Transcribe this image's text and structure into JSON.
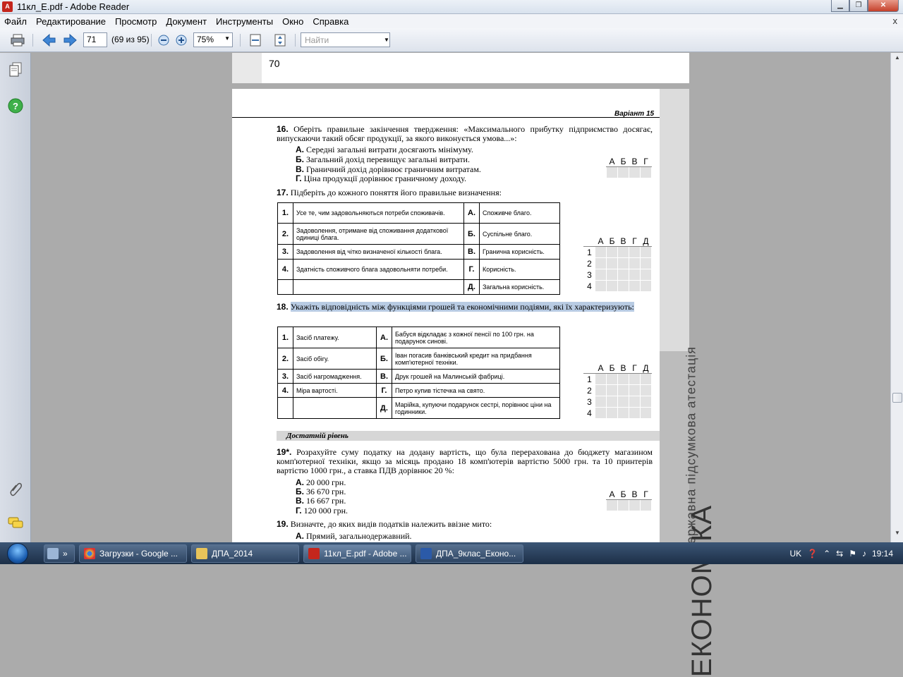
{
  "window": {
    "title": "11кл_Е.pdf - Adobe Reader"
  },
  "menu": [
    "Файл",
    "Редактирование",
    "Просмотр",
    "Документ",
    "Инструменты",
    "Окно",
    "Справка"
  ],
  "menu_close": "x",
  "toolbar": {
    "page_value": "71",
    "page_count": "(69 из 95)",
    "zoom": "75%",
    "find_placeholder": "Найти"
  },
  "prev_page_number": "70",
  "page": {
    "variant": "Варіант 15",
    "side_text_1": "Державна підсумкова атестація",
    "side_text_2": "ЕКОНОМІКА",
    "q16": {
      "number": "16.",
      "text": "Оберіть правильне закінчення твердження: «Максимального прибутку підприємство досягає, випускаючи такий обсяг продукції, за якого виконується умова...»:",
      "options": [
        {
          "letter": "А.",
          "text": "Середні загальні витрати досягають мінімуму."
        },
        {
          "letter": "Б.",
          "text": "Загальний дохід перевищує загальні витрати."
        },
        {
          "letter": "В.",
          "text": "Граничний дохід дорівнює граничним витратам."
        },
        {
          "letter": "Г.",
          "text": "Ціна продукції дорівнює граничному доходу."
        }
      ]
    },
    "q17": {
      "number": "17.",
      "text": "Підберіть до кожного поняття його правильне визначення:",
      "rows": [
        {
          "n": "1.",
          "left": "Усе те, чим задовольняються потреби споживачів.",
          "l": "А.",
          "right": "Споживче благо."
        },
        {
          "n": "2.",
          "left": "Задоволення, отримане від споживання додаткової одиниці блага.",
          "l": "Б.",
          "right": "Суспільне благо."
        },
        {
          "n": "3.",
          "left": "Задоволення від чітко визначеної кількості блага.",
          "l": "В.",
          "right": "Гранична корисність."
        },
        {
          "n": "4.",
          "left": "Здатність споживчого блага задовольняти потреби.",
          "l": "Г.",
          "right": "Корисність."
        },
        {
          "n": "",
          "left": "",
          "l": "Д.",
          "right": "Загальна корисність."
        }
      ]
    },
    "q18": {
      "number": "18.",
      "text": "Укажіть відповідність між функціями грошей та економічними подіями, які їх характеризують:",
      "rows": [
        {
          "n": "1.",
          "left": "Засіб платежу.",
          "l": "А.",
          "right": "Бабуся відкладає з кожної пенсії по 100 грн. на подарунок синові."
        },
        {
          "n": "2.",
          "left": "Засіб обігу.",
          "l": "Б.",
          "right": "Іван погасив банківський кредит на придбання комп'ютерної техніки."
        },
        {
          "n": "3.",
          "left": "Засіб нагромадження.",
          "l": "В.",
          "right": "Друк грошей на Малинській фабриці."
        },
        {
          "n": "4.",
          "left": "Міра вартості.",
          "l": "Г.",
          "right": "Петро купив тістечка на свято."
        },
        {
          "n": "",
          "left": "",
          "l": "Д.",
          "right": "Марійка, купуючи подарунок сестрі, порівнює ціни на годинники."
        }
      ]
    },
    "section_title": "Достатній рівень",
    "q19a": {
      "number": "19*.",
      "text": "Розрахуйте суму податку на додану вартість, що була перерахована до бюджету магазином комп'ютерної техніки, якщо за місяць продано 18 комп'ютерів вартістю 5000 грн. та 10 принтерів вартістю 1000 грн., а ставка ПДВ дорівнює 20 %:",
      "options": [
        {
          "letter": "А.",
          "text": "20 000 грн."
        },
        {
          "letter": "Б.",
          "text": "36 670 грн."
        },
        {
          "letter": "В.",
          "text": "16 667 грн."
        },
        {
          "letter": "Г.",
          "text": "120 000 грн."
        }
      ]
    },
    "q19b": {
      "number": "19.",
      "text": "Визначте, до яких видів податків належить ввізне мито:",
      "options": [
        {
          "letter": "А.",
          "text": "Прямий, загальнодержавний."
        }
      ]
    },
    "grid4_headers": [
      "А",
      "Б",
      "В",
      "Г"
    ],
    "grid5_headers": [
      "А",
      "Б",
      "В",
      "Г",
      "Д"
    ],
    "grid_rows": [
      "1",
      "2",
      "3",
      "4"
    ]
  },
  "taskbar": {
    "tasks": [
      "Загрузки - Google ...",
      "ДПА_2014",
      "11кл_Е.pdf - Adobe ...",
      "ДПА_9клас_Еконо..."
    ],
    "lang": "UK",
    "time": "19:14"
  }
}
